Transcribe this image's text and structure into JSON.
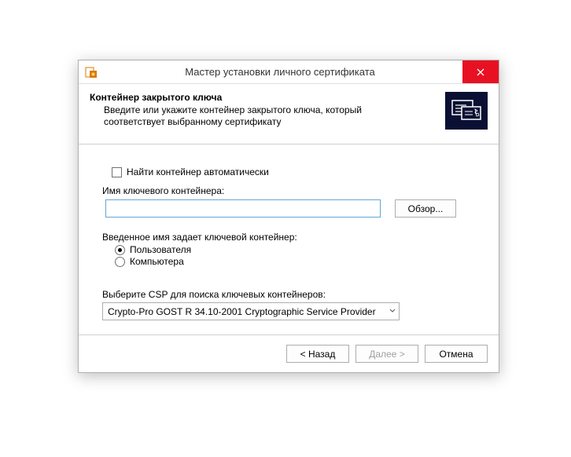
{
  "window": {
    "title": "Мастер установки личного сертификата"
  },
  "header": {
    "heading": "Контейнер закрытого ключа",
    "subheading": "Введите или укажите контейнер закрытого ключа, который соответствует выбранному сертификату"
  },
  "auto": {
    "checkbox_label": "Найти контейнер автоматически",
    "checked": false
  },
  "container": {
    "label": "Имя ключевого контейнера:",
    "value": "",
    "browse": "Обзор..."
  },
  "scope": {
    "label": "Введенное имя задает ключевой контейнер:",
    "options": {
      "user": "Пользователя",
      "computer": "Компьютера"
    },
    "selected": "user"
  },
  "csp": {
    "label": "Выберите CSP для поиска ключевых контейнеров:",
    "selected": "Crypto-Pro GOST R 34.10-2001 Cryptographic Service Provider"
  },
  "footer": {
    "back": "< Назад",
    "next": "Далее >",
    "cancel": "Отмена"
  }
}
